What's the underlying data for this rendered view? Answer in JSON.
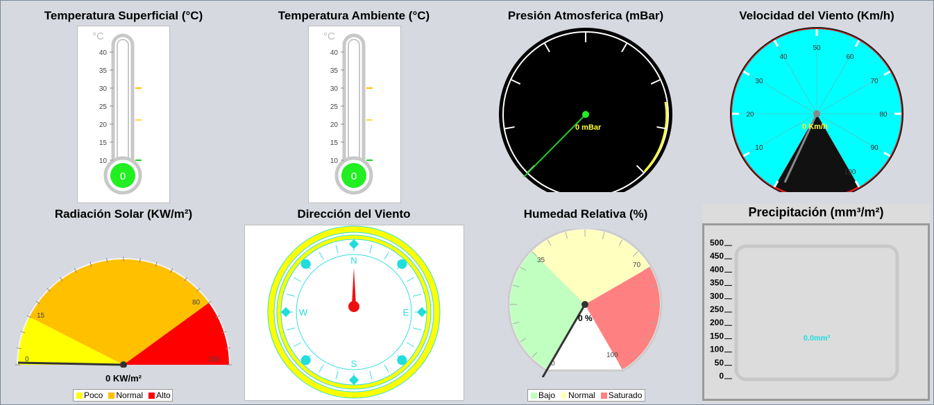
{
  "titles": {
    "temp_surface": "Temperatura Superficial (°C)",
    "temp_ambient": "Temperatura Ambiente (°C)",
    "pressure": "Presión Atmosferica (mBar)",
    "wind_speed": "Velocidad del Viento (Km/h)",
    "solar": "Radiación Solar (KW/m²)",
    "wind_dir": "Dirección del Viento",
    "humidity": "Humedad Relativa (%)",
    "precip": "Precipitación (mm³/m²)"
  },
  "thermometer": {
    "unit": "°C",
    "ticks": [
      "40",
      "35",
      "30",
      "25",
      "20",
      "15",
      "10"
    ],
    "surface_value": "0",
    "ambient_value": "0"
  },
  "pressure": {
    "readout": "0 mBar",
    "value": 0
  },
  "wind_speed": {
    "readout": "0 Km/h",
    "value": 0,
    "ticks": [
      "10",
      "20",
      "30",
      "40",
      "50",
      "60",
      "70",
      "80",
      "90",
      "100"
    ]
  },
  "solar": {
    "readout": "0 KW/m²",
    "value": 0,
    "ticks": [
      "0",
      "15",
      "80",
      "100"
    ],
    "legend": [
      {
        "label": "Poco",
        "color": "#ffff00"
      },
      {
        "label": "Normal",
        "color": "#ffc000"
      },
      {
        "label": "Alto",
        "color": "#ff0000"
      }
    ]
  },
  "wind_dir": {
    "n": "N",
    "e": "E",
    "s": "S",
    "w": "W",
    "value_deg": 0
  },
  "humidity": {
    "readout": "0 %",
    "value": 0,
    "ticks": [
      "0",
      "35",
      "70",
      "100"
    ],
    "legend": [
      {
        "label": "Bajo",
        "color": "#c0ffc0"
      },
      {
        "label": "Normal",
        "color": "#ffffc0"
      },
      {
        "label": "Saturado",
        "color": "#ff8080"
      }
    ]
  },
  "precip": {
    "readout": "0.0mm³",
    "value": 0,
    "ticks": [
      "500",
      "450",
      "400",
      "350",
      "300",
      "250",
      "200",
      "150",
      "100",
      "50",
      "0"
    ]
  }
}
